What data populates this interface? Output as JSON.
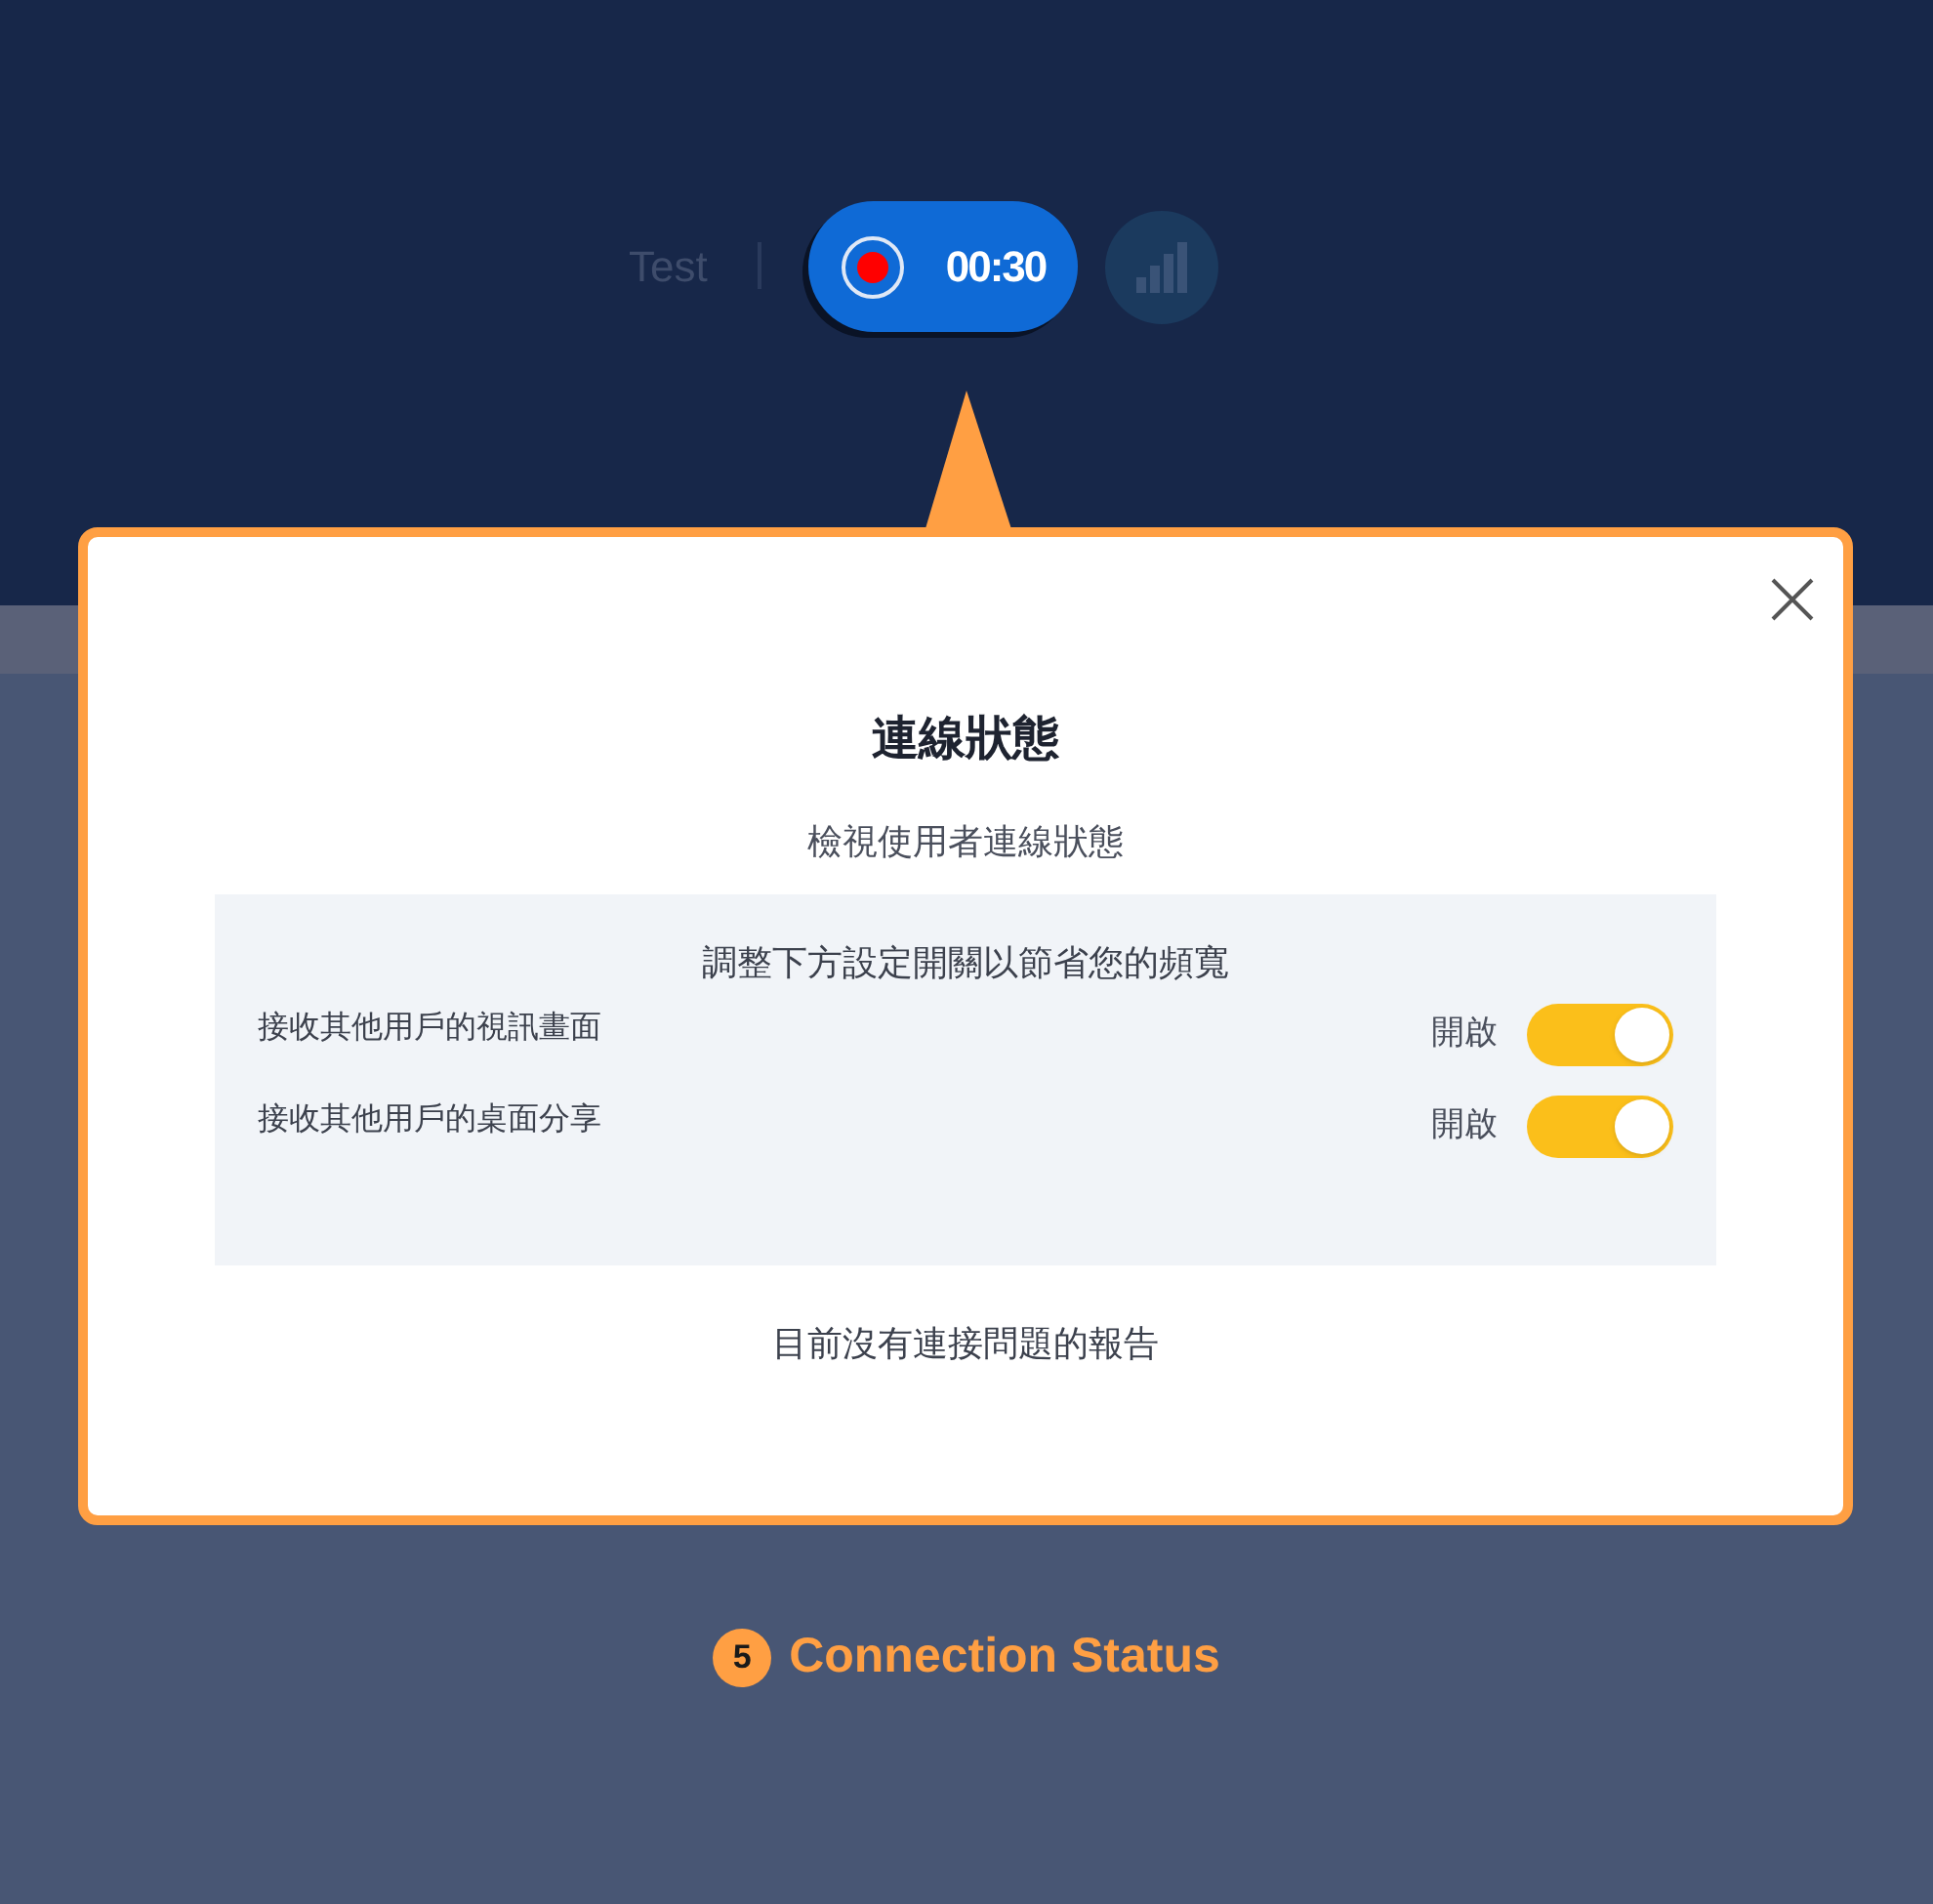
{
  "header": {
    "meeting_name": "Test",
    "recording": {
      "on": true,
      "time": "00:30"
    }
  },
  "dialog": {
    "title": "連線狀態",
    "subtitle": "檢視使用者連線狀態",
    "settings": {
      "heading": "調整下方設定開關以節省您的頻寬",
      "toggles": [
        {
          "label": "接收其他用戶的視訊畫面",
          "state_label": "開啟",
          "on": true
        },
        {
          "label": "接收其他用戶的桌面分享",
          "state_label": "開啟",
          "on": true
        }
      ]
    },
    "footer_note": "目前沒有連接問題的報告"
  },
  "caption": {
    "number": "5",
    "text": "Connection Status"
  }
}
